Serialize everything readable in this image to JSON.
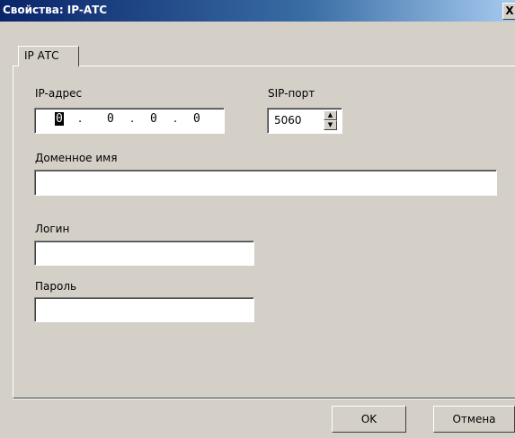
{
  "window": {
    "title": "Свойства: IP-АТС",
    "close_glyph": "X"
  },
  "tabs": [
    {
      "label": "IP АТС"
    }
  ],
  "form": {
    "ip_label": "IP-адрес",
    "ip_octets": [
      "0",
      "0",
      "0",
      "0"
    ],
    "ip_separator": ".",
    "sip_port_label": "SIP-порт",
    "sip_port_value": "5060",
    "domain_label": "Доменное имя",
    "domain_value": "",
    "login_label": "Логин",
    "login_value": "",
    "password_label": "Пароль",
    "password_value": ""
  },
  "buttons": {
    "ok": "OK",
    "cancel": "Отмена"
  }
}
